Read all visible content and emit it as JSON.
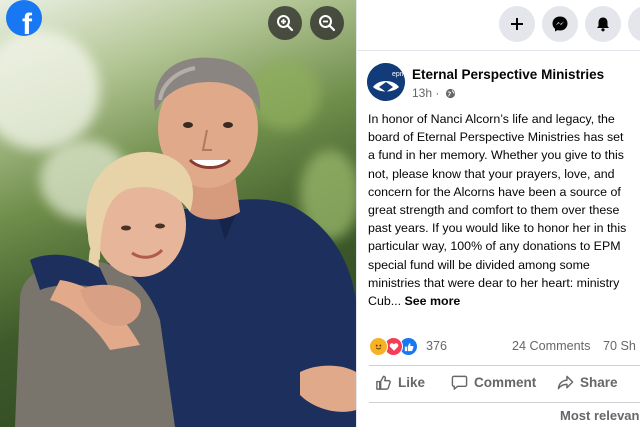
{
  "photo_viewer": {
    "logo": {
      "glyph": "f",
      "icon": "facebook-logo",
      "color": "#1877f2"
    },
    "zoom_in": {
      "icon": "zoom-in-icon"
    },
    "zoom_out": {
      "icon": "zoom-out-icon"
    }
  },
  "top_actions": [
    {
      "icon": "plus-icon"
    },
    {
      "icon": "messenger-icon"
    },
    {
      "icon": "bell-icon"
    }
  ],
  "post": {
    "author": "Eternal Perspective Ministries",
    "avatar_text": "epm",
    "timestamp": "13h",
    "visibility_icon": "globe-icon",
    "text_lines": [
      "In honor of Nanci Alcorn’s life and legacy, the",
      "board of Eternal Perspective Ministries has set",
      "a fund in her memory. Whether you give to this",
      "not, please know that your prayers, love, and",
      "concern for the Alcorns have been a source of",
      "great strength and comfort to them over these",
      "past years. If you would like to honor her in this",
      "particular way, 100% of any donations to EPM",
      "special fund will be divided among some",
      "ministries that were dear to her heart: ministry"
    ],
    "last_line": "Cub...",
    "see_more": "See more",
    "reaction_count": "376",
    "comments": "24 Comments",
    "shares": "70 Sh",
    "actions": {
      "like": "Like",
      "comment": "Comment",
      "share": "Share"
    },
    "sort": "Most relevan",
    "colors": {
      "like": "#1877f2",
      "love": "#f33e58",
      "care": "#f7b125"
    }
  }
}
